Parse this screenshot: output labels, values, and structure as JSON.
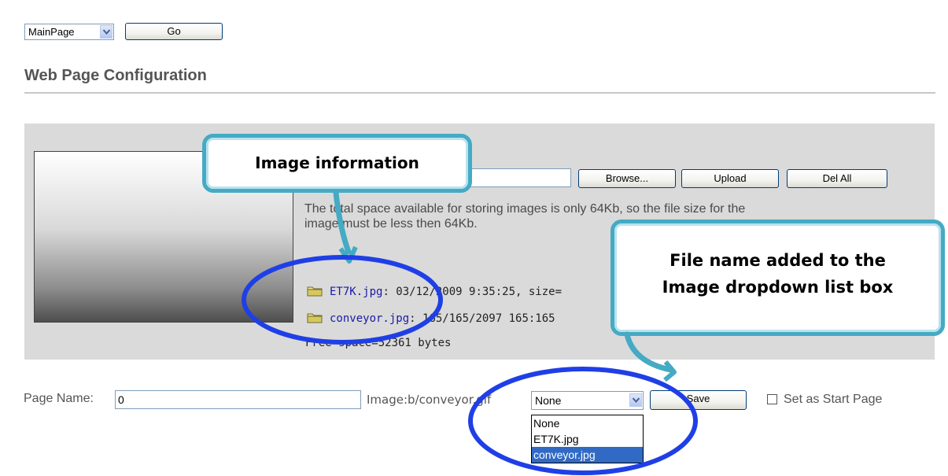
{
  "top": {
    "page_select_value": "MainPage",
    "go_label": "Go"
  },
  "title": "Web Page Configuration",
  "panel": {
    "browse_label": "Browse...",
    "upload_label": "Upload",
    "delall_label": "Del All",
    "notice": "The total space available for storing images is only 64Kb, so the file size for the image must be less then 64Kb.",
    "files": [
      {
        "name": "ET7K.jpg",
        "info": ": 03/12/2009 9:35:25, size="
      },
      {
        "name": "conveyor.jpg",
        "info": ": 165/165/2097 165:165"
      }
    ],
    "free_space": "Free space=52361 bytes"
  },
  "bottom": {
    "page_name_label": "Page Name:",
    "page_name_value": "0",
    "image_label": "Image:b/conveyor.gif",
    "image_select_value": "None",
    "save_label": "Save",
    "start_page_label": "Set as Start Page",
    "start_page_checked": false,
    "image_options": [
      "None",
      "ET7K.jpg",
      "conveyor.jpg"
    ],
    "image_option_highlighted": "conveyor.jpg"
  },
  "callouts": {
    "image_info": "Image information",
    "file_name_line1": "File name added to the",
    "file_name_line2": "Image dropdown list box"
  },
  "colors": {
    "callout_border": "#45aac4",
    "highlight_ellipse": "#1f3fe6",
    "panel_bg": "#dadada",
    "selection_bg": "#316ac5",
    "file_link": "#1a1aa8"
  },
  "icons": [
    "chevron-down-icon",
    "folder-icon"
  ]
}
